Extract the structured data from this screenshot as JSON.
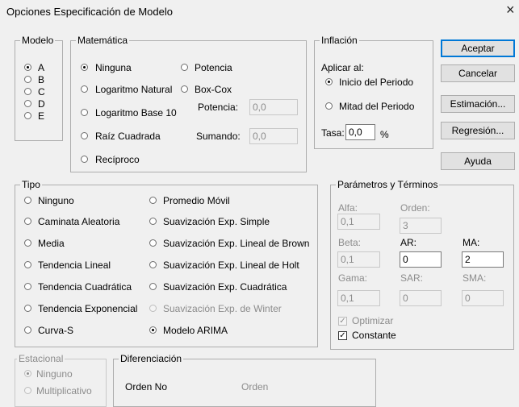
{
  "window": {
    "title": "Opciones Especificación de Modelo",
    "close": "×"
  },
  "modelo": {
    "legend": "Modelo",
    "options": [
      "A",
      "B",
      "C",
      "D",
      "E"
    ],
    "selected": "A"
  },
  "matematica": {
    "legend": "Matemática",
    "options": [
      "Ninguna",
      "Potencia",
      "Logaritmo Natural",
      "Box-Cox",
      "Logaritmo Base 10",
      "Raíz Cuadrada",
      "Recíproco"
    ],
    "selected": "Ninguna",
    "potencia_label": "Potencia:",
    "potencia_value": "0,0",
    "sumando_label": "Sumando:",
    "sumando_value": "0,0"
  },
  "inflacion": {
    "legend": "Inflación",
    "aplicar_label": "Aplicar al:",
    "options": [
      "Inicio del Periodo",
      "Mitad del Periodo"
    ],
    "selected": "Inicio del Periodo",
    "tasa_label": "Tasa:",
    "tasa_value": "0,0",
    "tasa_unit": "%"
  },
  "buttons": {
    "aceptar": "Aceptar",
    "cancelar": "Cancelar",
    "estimacion": "Estimación...",
    "regresion": "Regresión...",
    "ayuda": "Ayuda"
  },
  "tipo": {
    "legend": "Tipo",
    "left": [
      "Ninguno",
      "Caminata Aleatoria",
      "Media",
      "Tendencia Lineal",
      "Tendencia Cuadrática",
      "Tendencia Exponencial",
      "Curva-S"
    ],
    "right": [
      "Promedio Móvil",
      "Suavización Exp. Simple",
      "Suavización Exp. Lineal de Brown",
      "Suavización Exp. Lineal de Holt",
      "Suavización Exp. Cuadrática",
      "Suavización Exp. de Winter",
      "Modelo ARIMA"
    ],
    "selected": "Modelo ARIMA"
  },
  "parametros": {
    "legend": "Parámetros y Términos",
    "alfa_label": "Alfa:",
    "alfa_value": "0,1",
    "orden_label": "Orden:",
    "orden_value": "3",
    "beta_label": "Beta:",
    "beta_value": "0,1",
    "ar_label": "AR:",
    "ar_value": "0",
    "ma_label": "MA:",
    "ma_value": "2",
    "gama_label": "Gama:",
    "gama_value": "0,1",
    "sar_label": "SAR:",
    "sar_value": "0",
    "sma_label": "SMA:",
    "sma_value": "0",
    "optimizar_label": "Optimizar",
    "optimizar_checked": true,
    "constante_label": "Constante",
    "constante_checked": true
  },
  "estacional": {
    "legend": "Estacional",
    "options": [
      "Ninguno",
      "Multiplicativo"
    ],
    "selected": "Ninguno"
  },
  "diferenciacion": {
    "legend": "Diferenciación",
    "orden_no_label": "Orden No",
    "orden_label": "Orden"
  }
}
